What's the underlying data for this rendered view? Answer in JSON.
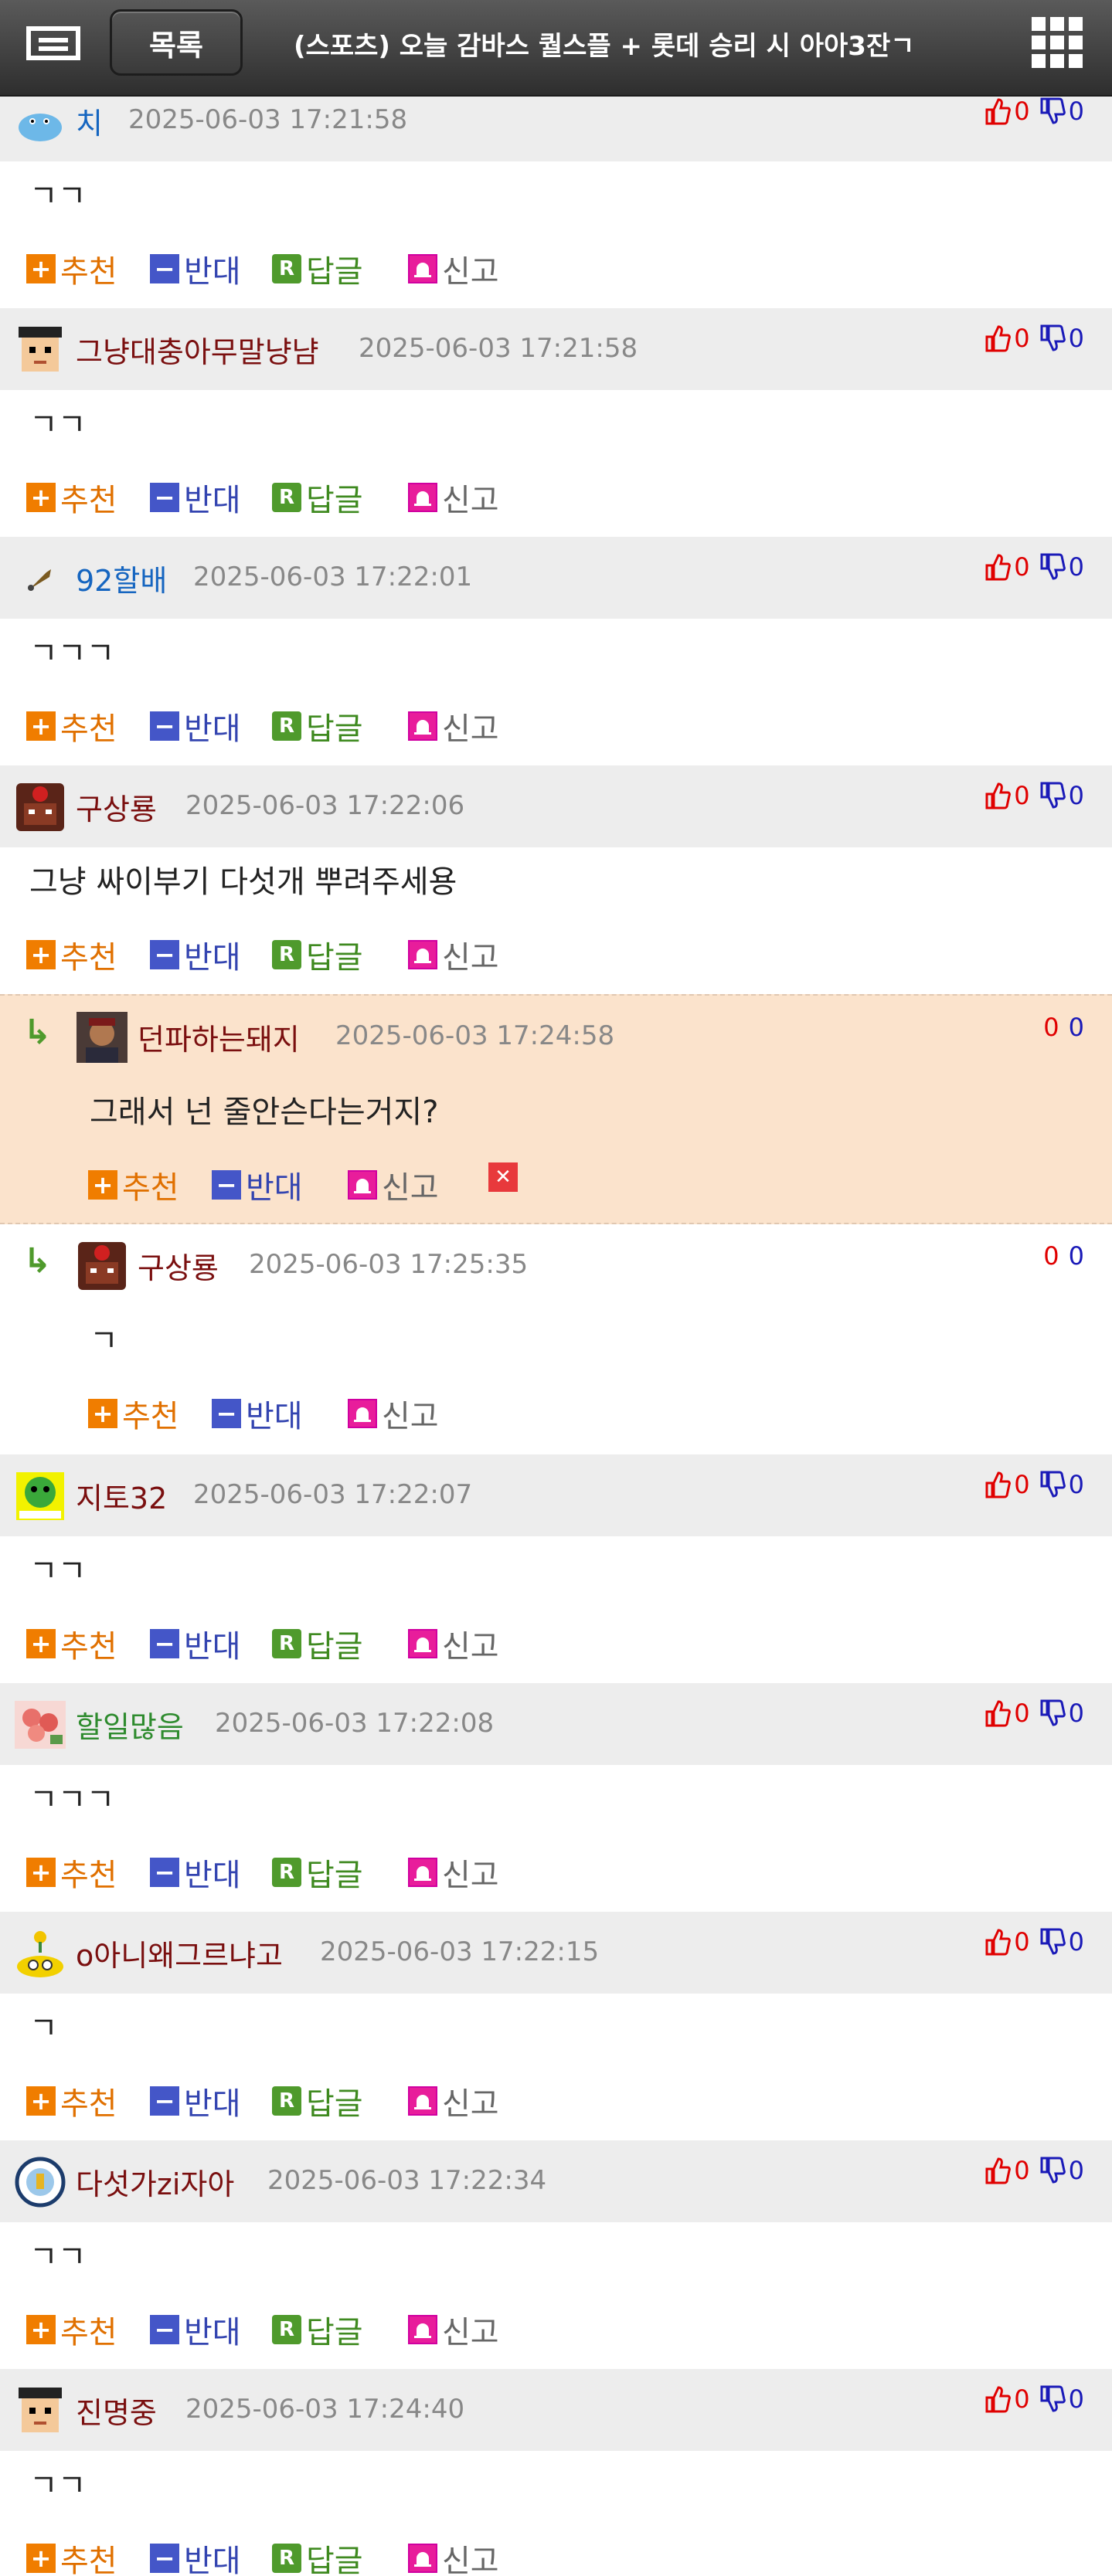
{
  "header": {
    "list_label": "목록",
    "title": "(스포츠) 오늘 감바스 퀄스플 + 롯데 승리 시 아아3잔ㄱ"
  },
  "actions": {
    "recommend": "추천",
    "oppose": "반대",
    "reply": "답글",
    "report": "신고",
    "reply_icon": "R"
  },
  "comments": [
    {
      "nick": "치",
      "time": "2025-06-03 17:21:58",
      "up": "0",
      "down": "0",
      "body": "ㄱㄱ",
      "avatar_icon": "hippo-icon"
    },
    {
      "nick": "그냥대충아무말냥냠",
      "time": "2025-06-03 17:21:58",
      "up": "0",
      "down": "0",
      "body": "ㄱㄱ",
      "avatar_icon": "pixel-face-icon"
    },
    {
      "nick": "92할배",
      "time": "2025-06-03 17:22:01",
      "up": "0",
      "down": "0",
      "body": "ㄱㄱㄱ",
      "avatar_icon": "trumpet-icon"
    },
    {
      "nick": "구상룡",
      "time": "2025-06-03 17:22:06",
      "up": "0",
      "down": "0",
      "body": "그냥 싸이부기 다섯개 뿌려주세용",
      "avatar_icon": "lotte-mascot-icon"
    },
    {
      "nick": "지토32",
      "time": "2025-06-03 17:22:07",
      "up": "0",
      "down": "0",
      "body": "ㄱㄱ",
      "avatar_icon": "green-monster-icon"
    },
    {
      "nick": "할일많음",
      "time": "2025-06-03 17:22:08",
      "up": "0",
      "down": "0",
      "body": "ㄱㄱㄱ",
      "avatar_icon": "flower-icon"
    },
    {
      "nick": "o아니왜그르냐고",
      "time": "2025-06-03 17:22:15",
      "up": "0",
      "down": "0",
      "body": "ㄱ",
      "avatar_icon": "minion-icon"
    },
    {
      "nick": "다섯가zi자아",
      "time": "2025-06-03 17:22:34",
      "up": "0",
      "down": "0",
      "body": "ㄱㄱ",
      "avatar_icon": "city-badge-icon"
    },
    {
      "nick": "진명중",
      "time": "2025-06-03 17:24:40",
      "up": "0",
      "down": "0",
      "body": "ㄱㄱ",
      "avatar_icon": "pixel-face-icon"
    }
  ],
  "replies": [
    {
      "nick": "던파하는돼지",
      "time": "2025-06-03 17:24:58",
      "up": "0",
      "down": "0",
      "body": "그래서 넌 줄안슨다는거지?",
      "avatar_icon": "portrait-icon"
    },
    {
      "nick": "구상룡",
      "time": "2025-06-03 17:25:35",
      "up": "0",
      "down": "0",
      "body": "ㄱ",
      "avatar_icon": "lotte-mascot-icon"
    }
  ],
  "colors": {
    "header_bg": "#3a3a3a",
    "comment_head_bg": "#ededed",
    "reply_highlight_bg": "#fbe3cc",
    "up_color": "#e00000",
    "down_color": "#1a1ab8",
    "recommend_color": "#f07d00",
    "oppose_color": "#4456c8",
    "reply_color": "#4f9a2c",
    "report_color": "#e81d9b"
  }
}
